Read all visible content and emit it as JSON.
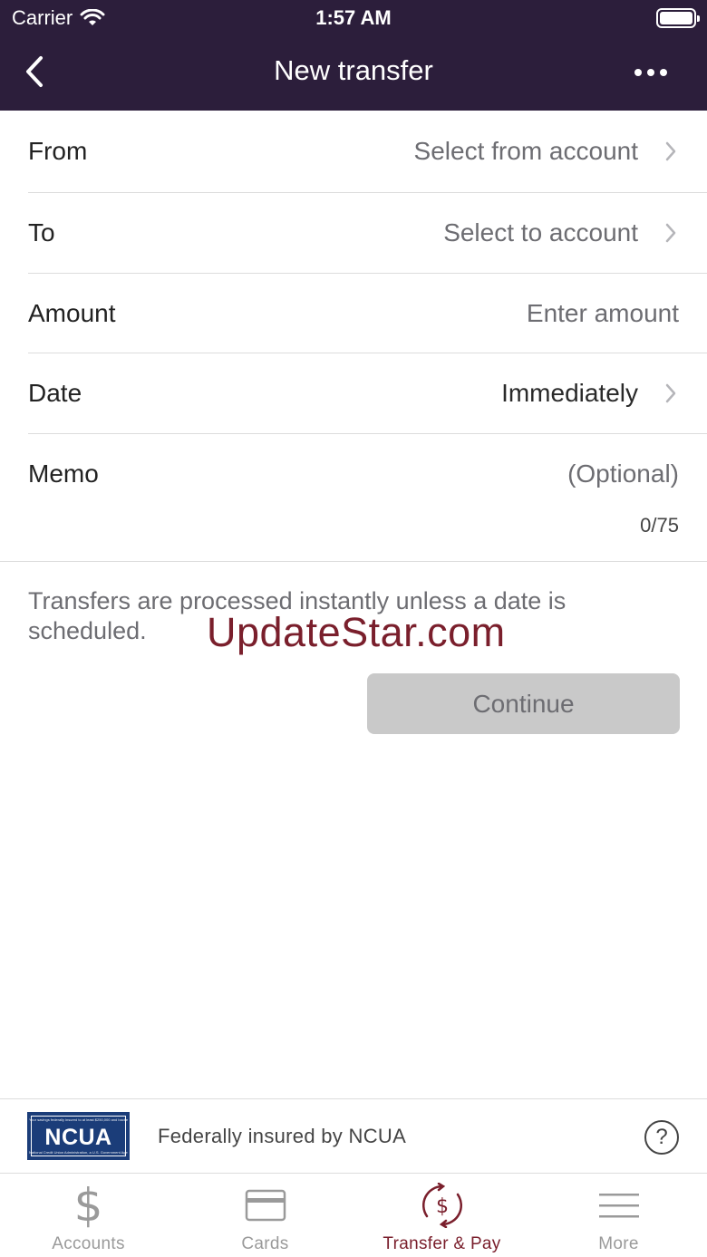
{
  "status_bar": {
    "carrier": "Carrier",
    "time": "1:57 AM"
  },
  "nav": {
    "title": "New transfer"
  },
  "form": {
    "from": {
      "label": "From",
      "value": "Select from account"
    },
    "to": {
      "label": "To",
      "value": "Select to account"
    },
    "amount": {
      "label": "Amount",
      "placeholder": "Enter amount"
    },
    "date": {
      "label": "Date",
      "value": "Immediately"
    },
    "memo": {
      "label": "Memo",
      "placeholder": "(Optional)",
      "count": "0/75"
    }
  },
  "info_text": "Transfers are processed instantly unless a date is scheduled.",
  "watermark": "UpdateStar.com",
  "continue_label": "Continue",
  "ncua": {
    "logo_text": "NCUA",
    "logo_top": "Your savings federally insured to at least $250,000 and backed by the full faith and credit of the United States Government",
    "logo_bottom": "National Credit Union Administration, a U.S. Government Agency",
    "text": "Federally insured by NCUA",
    "help": "?"
  },
  "tabs": [
    {
      "label": "Accounts",
      "icon": "dollar-icon",
      "active": false
    },
    {
      "label": "Cards",
      "icon": "card-icon",
      "active": false
    },
    {
      "label": "Transfer & Pay",
      "icon": "transfer-pay-icon",
      "active": true
    },
    {
      "label": "More",
      "icon": "hamburger-menu-icon",
      "active": false
    }
  ],
  "colors": {
    "header_bg": "#2c1e3b",
    "accent": "#7a1f2c",
    "ncua_blue": "#1b3d79",
    "button_disabled": "#c9c9c9"
  }
}
